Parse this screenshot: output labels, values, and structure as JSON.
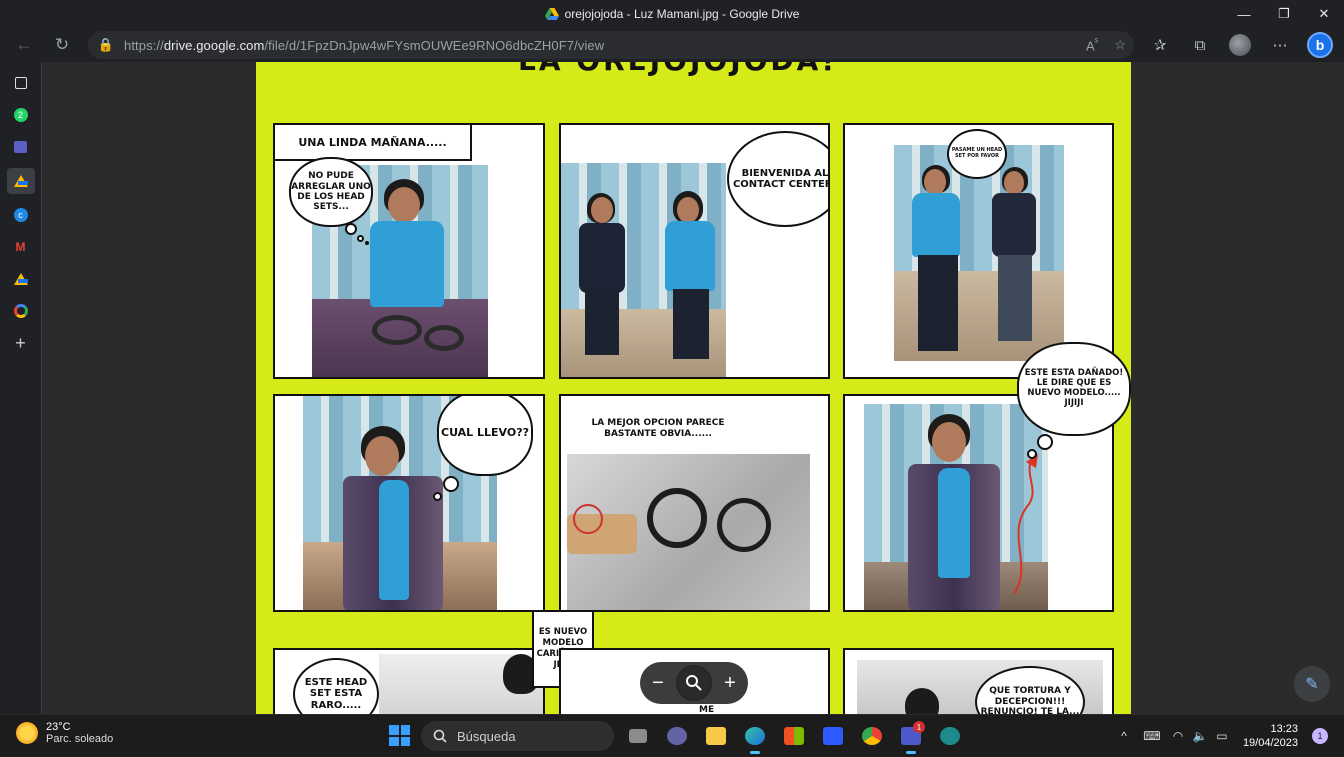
{
  "window": {
    "title": "orejojojoda - Luz Mamani.jpg - Google Drive",
    "minimize": "—",
    "maximize": "❐",
    "close": "✕"
  },
  "toolbar": {
    "url_prefix": "https://",
    "url_domain": "drive.google.com",
    "url_path": "/file/d/1FpzDnJpw4wFYsmOUWEe9RNO6dbcZH0F7/view"
  },
  "comic": {
    "top_text": "LA OREJOJOJODA!",
    "panel1": {
      "caption": "UNA LINDA MAÑANA.....",
      "thought": "NO PUDE ARREGLAR UNO DE LOS HEAD SETS..."
    },
    "panel2": {
      "speech": "BIENVENIDA AL CONTACT CENTER!"
    },
    "panel3": {
      "speech": "PASAME UN HEAD SET POR FAVOR"
    },
    "panel4": {
      "thought": "CUAL LLEVO??"
    },
    "panel5": {
      "caption": "LA MEJOR OPCION PARECE BASTANTE OBVIA......"
    },
    "panel6": {
      "thought": "ESTE ESTA DAÑADO! LE DIRE QUE ES NUEVO MODELO..... JIJIJI"
    },
    "panel7": {
      "speech": "ESTE HEAD SET ESTA RARO.....",
      "reply": "ES NUEVO MODELO CARIÑO..... JIJIJI"
    },
    "panel8": {
      "speech": "AAH!!! ME DUELE!"
    },
    "panel9": {
      "speech": "QUE TORTURA Y DECEPCION!!! RENUNCIO! TE LA..."
    }
  },
  "zoom": {
    "minus": "−",
    "plus": "+"
  },
  "taskbar": {
    "temperature": "23°C",
    "weather": "Parc. soleado",
    "search_placeholder": "Búsqueda",
    "time": "13:23",
    "date": "19/04/2023",
    "teams_badge": "1",
    "notifications": "1"
  },
  "sidebar": {
    "whatsapp_badge": "2"
  }
}
